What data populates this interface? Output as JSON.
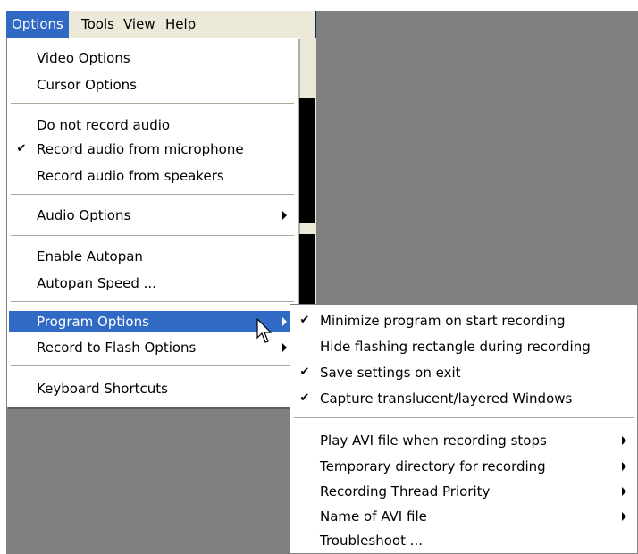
{
  "menubar": {
    "items": [
      "Options",
      "Tools",
      "View",
      "Help"
    ],
    "active": "Options"
  },
  "options_menu": {
    "items": [
      {
        "label": "Video Options"
      },
      {
        "label": "Cursor Options"
      },
      {
        "label": "Do not record audio"
      },
      {
        "label": "Record audio from microphone",
        "checked": true
      },
      {
        "label": "Record audio from speakers"
      },
      {
        "label": "Audio Options",
        "submenu": true
      },
      {
        "label": "Enable Autopan"
      },
      {
        "label": "Autopan Speed ..."
      },
      {
        "label": "Program Options",
        "submenu": true,
        "highlighted": true
      },
      {
        "label": "Record to Flash Options",
        "submenu": true
      },
      {
        "label": "Keyboard Shortcuts"
      }
    ]
  },
  "program_options_submenu": {
    "items": [
      {
        "label": "Minimize program on start recording",
        "checked": true
      },
      {
        "label": "Hide flashing rectangle during recording"
      },
      {
        "label": "Save settings on exit",
        "checked": true
      },
      {
        "label": "Capture translucent/layered Windows",
        "checked": true
      },
      {
        "label": "Play AVI file when recording stops",
        "submenu": true
      },
      {
        "label": "Temporary directory for recording",
        "submenu": true
      },
      {
        "label": "Recording Thread Priority",
        "submenu": true
      },
      {
        "label": "Name of AVI file",
        "submenu": true
      },
      {
        "label": "Troubleshoot ..."
      }
    ]
  },
  "icons": {
    "check": "checkmark-icon",
    "submenu_arrow": "submenu-arrow-icon",
    "cursor": "mouse-pointer-icon"
  },
  "colors": {
    "highlight": "#316ac5",
    "menu_bg": "#ffffff",
    "menubar_bg": "#ece9d8",
    "desktop_bg": "#808080"
  }
}
